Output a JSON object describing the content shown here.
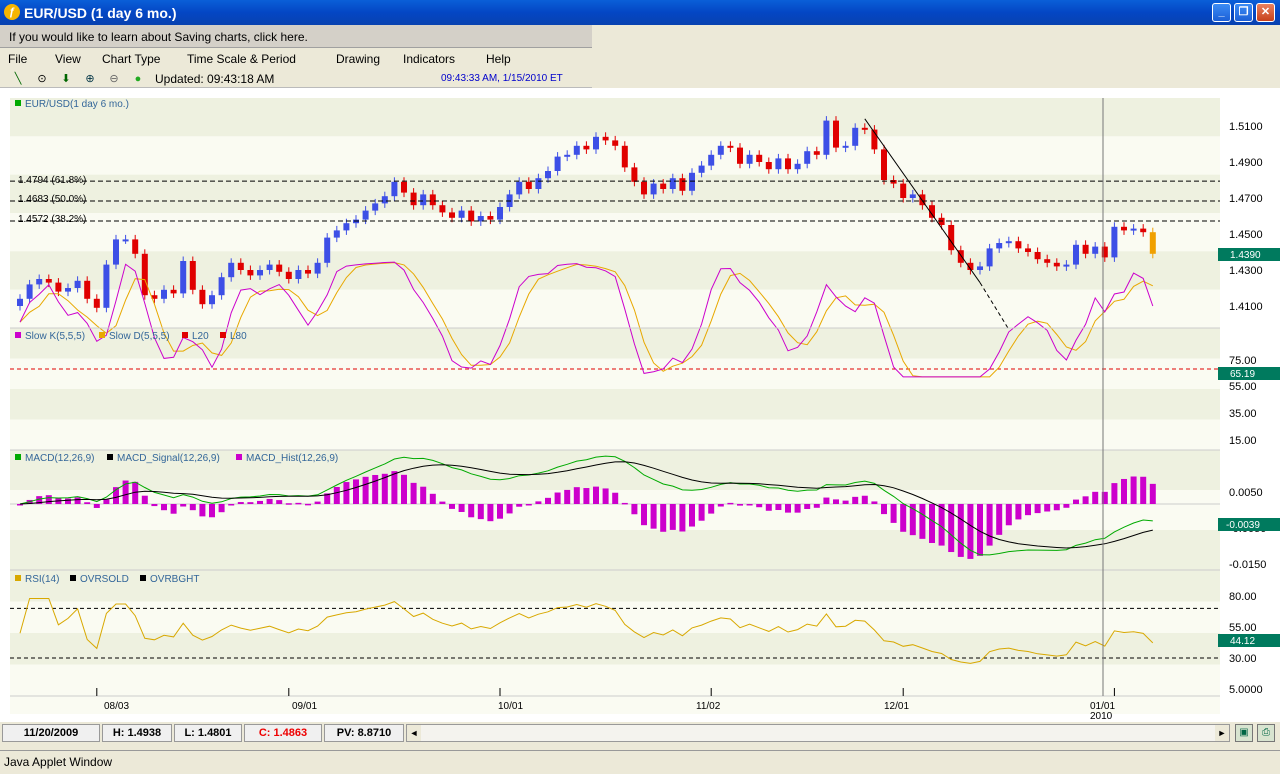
{
  "window": {
    "title": "EUR/USD (1 day  6 mo.)",
    "minimize": "_",
    "maximize": "❐",
    "close": "✕"
  },
  "promo": "If you would like to learn about Saving charts, click here.",
  "menu": [
    "File",
    "View",
    "Chart Type",
    "Time Scale & Period",
    "Drawing",
    "Indicators",
    "Help"
  ],
  "toolbar": {
    "updated": "Updated: 09:43:18 AM",
    "now": "09:43:33 AM, 1/15/2010 ET",
    "icons": [
      "trendline-icon",
      "crosshair-icon",
      "down-arrow-icon",
      "zoom-in-icon",
      "zoom-out-icon",
      "refresh-icon"
    ]
  },
  "colors": {
    "up": "#3d4fe6",
    "down": "#e00000",
    "stochK": "#cc00cc",
    "stochD": "#e8a800",
    "macd": "#00aa00",
    "signal": "#000000",
    "hist": "#cc00cc",
    "rsi": "#d8a800",
    "badge": "#007a5e"
  },
  "chart_data": [
    {
      "type": "candlestick",
      "legend": "EUR/USD(1 day  6 mo.)",
      "yticks": [
        "1.5100",
        "1.4900",
        "1.4700",
        "1.4500",
        "1.4300",
        "1.4100"
      ],
      "last_price": "1.4390",
      "fib_levels": [
        {
          "label": "1.4794 (61.8%)",
          "value": 1.4794
        },
        {
          "label": "1.4683 (50.0%)",
          "value": 1.4683
        },
        {
          "label": "1.4572 (38.2%)",
          "value": 1.4572
        }
      ],
      "closes": [
        1.414,
        1.422,
        1.425,
        1.423,
        1.418,
        1.42,
        1.424,
        1.414,
        1.409,
        1.433,
        1.447,
        1.447,
        1.439,
        1.416,
        1.414,
        1.419,
        1.417,
        1.435,
        1.419,
        1.411,
        1.416,
        1.426,
        1.434,
        1.43,
        1.427,
        1.43,
        1.433,
        1.429,
        1.425,
        1.43,
        1.428,
        1.434,
        1.448,
        1.452,
        1.456,
        1.458,
        1.463,
        1.467,
        1.471,
        1.479,
        1.473,
        1.466,
        1.472,
        1.466,
        1.462,
        1.459,
        1.463,
        1.457,
        1.46,
        1.458,
        1.465,
        1.472,
        1.479,
        1.475,
        1.481,
        1.485,
        1.493,
        1.494,
        1.499,
        1.497,
        1.504,
        1.502,
        1.499,
        1.487,
        1.479,
        1.472,
        1.478,
        1.475,
        1.481,
        1.474,
        1.484,
        1.488,
        1.494,
        1.499,
        1.498,
        1.489,
        1.494,
        1.49,
        1.486,
        1.492,
        1.486,
        1.489,
        1.496,
        1.494,
        1.513,
        1.498,
        1.499,
        1.509,
        1.508,
        1.497,
        1.48,
        1.478,
        1.47,
        1.472,
        1.466,
        1.459,
        1.455,
        1.441,
        1.434,
        1.43,
        1.432,
        1.442,
        1.445,
        1.446,
        1.442,
        1.44,
        1.436,
        1.434,
        1.432,
        1.433,
        1.444,
        1.439,
        1.443,
        1.437,
        1.454,
        1.452,
        1.453,
        1.451,
        1.439
      ]
    },
    {
      "type": "line",
      "legend": [
        "Slow K(5,5,5)",
        "Slow D(5,5,5)",
        "L20",
        "L80"
      ],
      "yticks": [
        "75.00",
        "55.00",
        "35.00",
        "15.00"
      ],
      "last": "65.19"
    },
    {
      "type": "line",
      "legend": [
        "MACD(12,26,9)",
        "MACD_Signal(12,26,9)",
        "MACD_Hist(12,26,9)"
      ],
      "yticks": [
        "0.0050",
        "-0.0050",
        "-0.0150"
      ],
      "last": "-0.0039"
    },
    {
      "type": "line",
      "legend": [
        "RSI(14)",
        "OVRSOLD",
        "OVRBGHT"
      ],
      "yticks": [
        "80.00",
        "55.00",
        "30.00",
        "5.0000"
      ],
      "last": "44.12"
    }
  ],
  "xaxis": [
    {
      "label": "08/03",
      "idx": 8
    },
    {
      "label": "09/01",
      "idx": 28
    },
    {
      "label": "10/01",
      "idx": 50
    },
    {
      "label": "11/02",
      "idx": 72
    },
    {
      "label": "12/01",
      "idx": 92
    },
    {
      "label": "01/01",
      "idx": 114,
      "year": "2010"
    }
  ],
  "statusbar": {
    "date": "11/20/2009",
    "high": "H: 1.4938",
    "low": "L: 1.4801",
    "close": "C: 1.4863",
    "pv": "PV: 8.8710",
    "left": "◄",
    "right": "►"
  },
  "applet": "Java Applet Window"
}
